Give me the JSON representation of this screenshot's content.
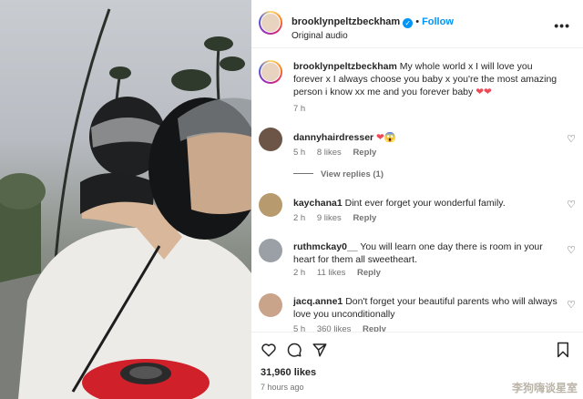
{
  "post": {
    "username": "brooklynpeltzbeckham",
    "verified_glyph": "✓",
    "dot": "•",
    "follow_label": "Follow",
    "audio": "Original audio",
    "more_glyph": "•••"
  },
  "caption": {
    "username": "brooklynpeltzbeckham",
    "text": "My whole world x I will love you forever x I always choose you baby x you're the most amazing person i know xx me and you forever baby",
    "emoji": "❤❤",
    "time": "7 h"
  },
  "comments": [
    {
      "username": "dannyhairdresser",
      "text": "",
      "emoji": "❤😱",
      "time": "5 h",
      "likes": "8 likes",
      "reply": "Reply"
    },
    {
      "username": "kaychana1",
      "text": "Dint ever forget your wonderful family.",
      "time": "2 h",
      "likes": "9 likes",
      "reply": "Reply"
    },
    {
      "username": "ruthmckay0__",
      "text": "You will learn one day there is room in your heart for them all sweetheart.",
      "time": "2 h",
      "likes": "11 likes",
      "reply": "Reply"
    },
    {
      "username": "jacq.anne1",
      "text": "Don't forget your beautiful parents who will always love you unconditionally",
      "time": "5 h",
      "likes": "360 likes",
      "reply": "Reply"
    }
  ],
  "view_replies": "View replies (1)",
  "heart_glyph": "♡",
  "footer": {
    "likes": "31,960 likes",
    "time": "7 hours ago"
  },
  "watermark": "李狗嗨谈星室",
  "colors": {
    "accent": "#0095f6",
    "heart": "#ed4956",
    "muted": "#737373"
  },
  "icons": [
    "heart-icon",
    "comment-icon",
    "share-icon",
    "bookmark-icon",
    "verified-icon",
    "more-icon"
  ]
}
